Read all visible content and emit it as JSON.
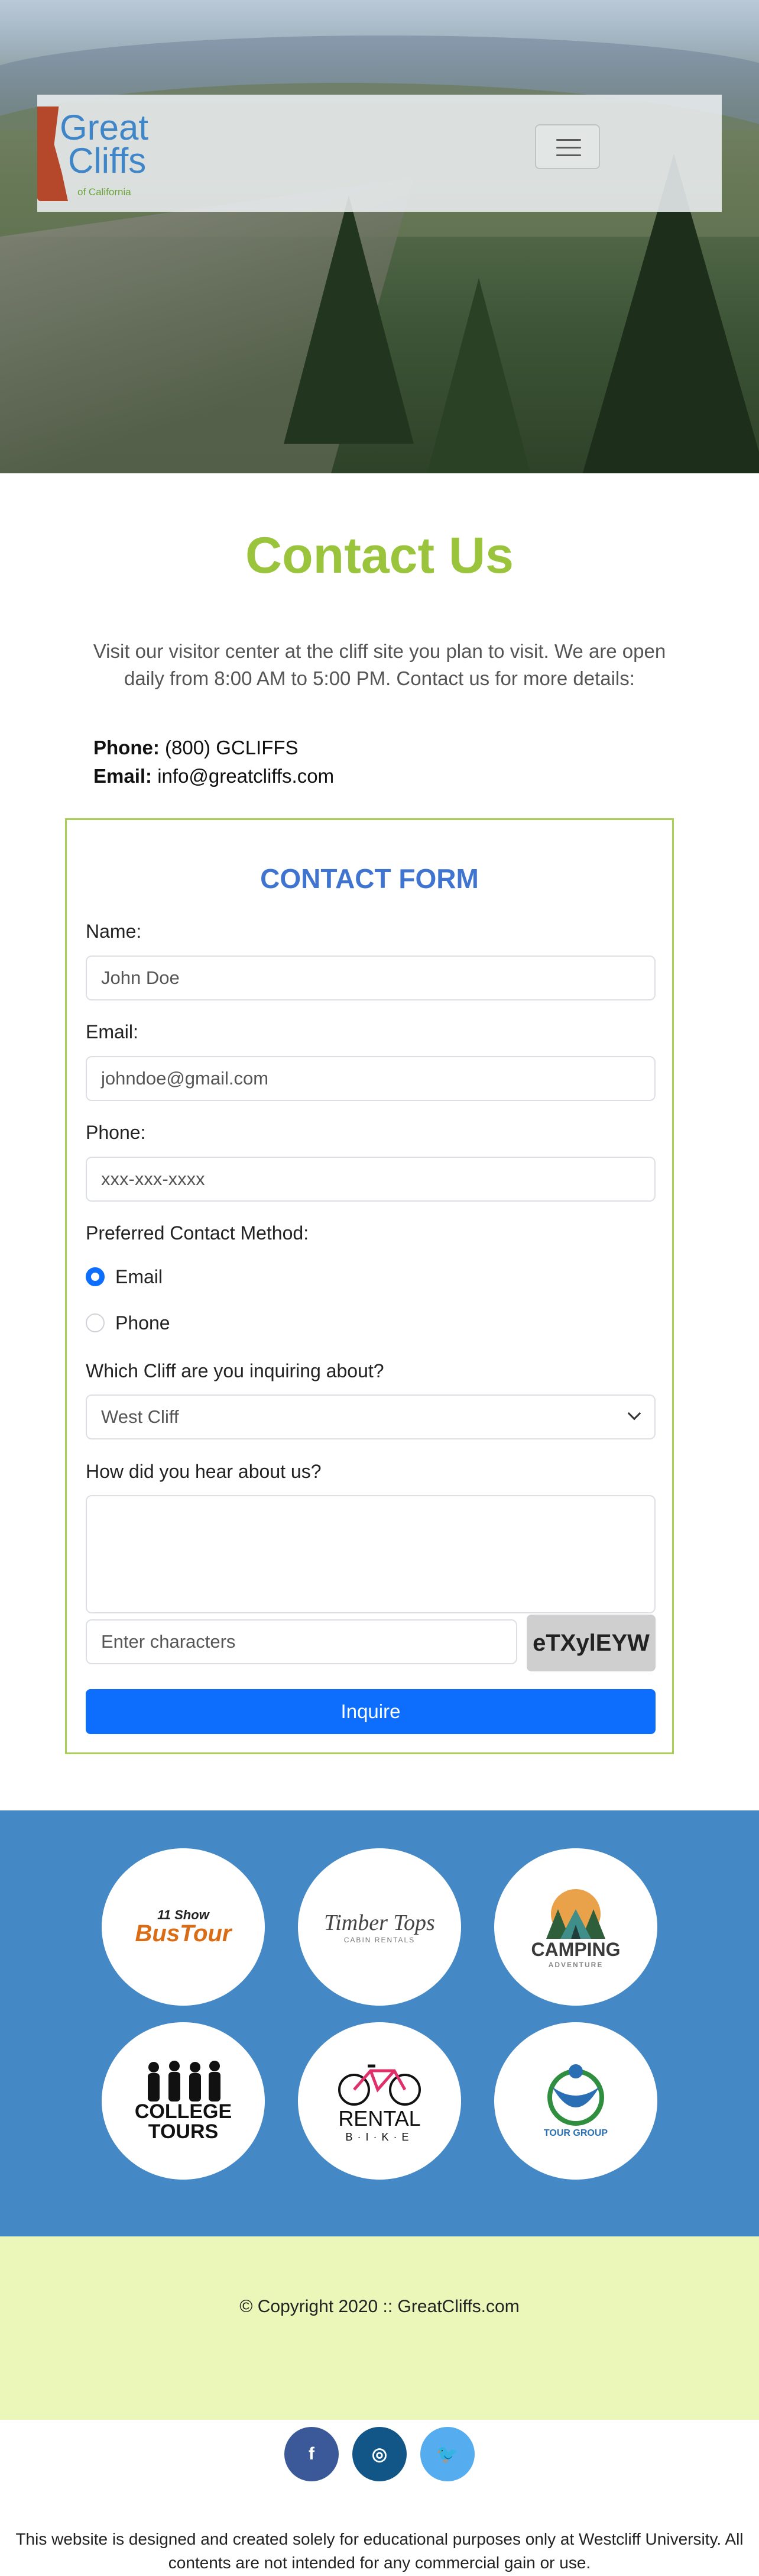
{
  "header": {
    "logo": {
      "line1": "Great",
      "line2": "Cliffs",
      "line3": "of California"
    }
  },
  "page": {
    "title": "Contact Us",
    "intro": "Visit our visitor center at the cliff site you plan to visit. We are open daily from 8:00 AM to 5:00 PM. Contact us for more details:",
    "phone_label": "Phone:",
    "phone_value": "(800) GCLIFFS",
    "email_label": "Email:",
    "email_value": "info@greatcliffs.com"
  },
  "form": {
    "title": "CONTACT FORM",
    "name_label": "Name:",
    "name_placeholder": "John Doe",
    "email_label": "Email:",
    "email_placeholder": "johndoe@gmail.com",
    "phone_label": "Phone:",
    "phone_placeholder": "xxx-xxx-xxxx",
    "method_label": "Preferred Contact Method:",
    "method_options": [
      "Email",
      "Phone"
    ],
    "method_selected": "Email",
    "cliff_label": "Which Cliff are you inquiring about?",
    "cliff_selected": "West Cliff",
    "hear_label": "How did you hear about us?",
    "hear_value": "",
    "captcha_placeholder": "Enter characters",
    "captcha_code": "eTXylEYW",
    "submit_label": "Inquire",
    "accent_color": "#0d6efd"
  },
  "partners": {
    "bus": {
      "line1": "11 Show",
      "line2": "BusTour"
    },
    "timber": {
      "line1": "Timber Tops",
      "line2": "CABIN RENTALS"
    },
    "camping": {
      "line1": "CAMPING",
      "line2": "ADVENTURE"
    },
    "college": {
      "line1": "COLLEGE",
      "line2": "TOURS"
    },
    "rental": {
      "line1": "RENTAL",
      "line2": "B·I·K·E"
    },
    "tour": {
      "line1": "TOUR GROUP"
    }
  },
  "footer": {
    "copyright": "© Copyright 2020 :: GreatCliffs.com",
    "social": [
      {
        "icon": "facebook-icon",
        "glyph": "f",
        "color": "#3b5998"
      },
      {
        "icon": "instagram-icon",
        "glyph": "◎",
        "color": "#125688"
      },
      {
        "icon": "twitter-icon",
        "glyph": "🐦",
        "color": "#55acee"
      }
    ],
    "disclaimer": "This website is designed and created solely for educational purposes only at Westcliff University. All contents are not intended for any commercial gain or use."
  }
}
